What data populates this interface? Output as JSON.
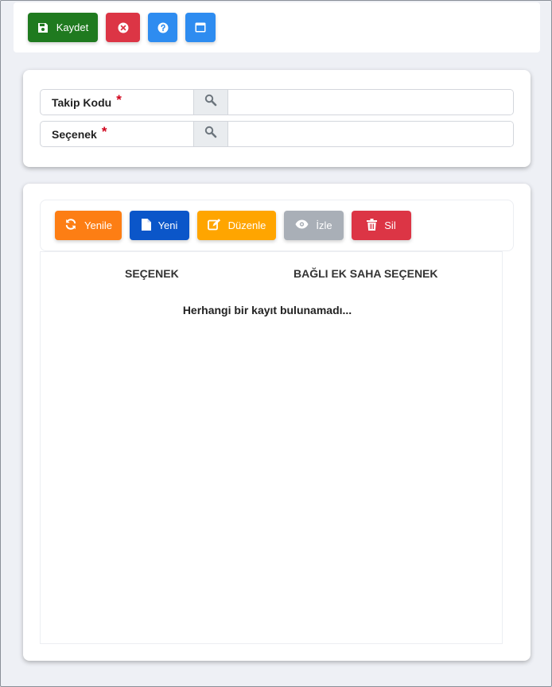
{
  "toolbar": {
    "save_label": "Kaydet",
    "icons": {
      "save": "floppy-disk-icon",
      "close": "close-circle-icon",
      "help": "question-circle-icon",
      "window": "window-icon"
    }
  },
  "form": {
    "fields": [
      {
        "label": "Takip Kodu",
        "required": "*",
        "value": ""
      },
      {
        "label": "Seçenek",
        "required": "*",
        "value": ""
      }
    ]
  },
  "grid": {
    "buttons": {
      "refresh": "Yenile",
      "new": "Yeni",
      "edit": "Düzenle",
      "view": "İzle",
      "delete": "Sil"
    },
    "columns": [
      "SEÇENEK",
      "BAĞLI EK SAHA SEÇENEK"
    ],
    "empty_message": "Herhangi bir kayıt bulunamadı..."
  },
  "colors": {
    "save": "#1f7a1f",
    "danger": "#dc3545",
    "info": "#2e8cf0",
    "refresh": "#fd7e14",
    "new": "#0b56c9",
    "edit": "#ffa500",
    "view": "#a9afb7",
    "required": "#d0021b"
  }
}
